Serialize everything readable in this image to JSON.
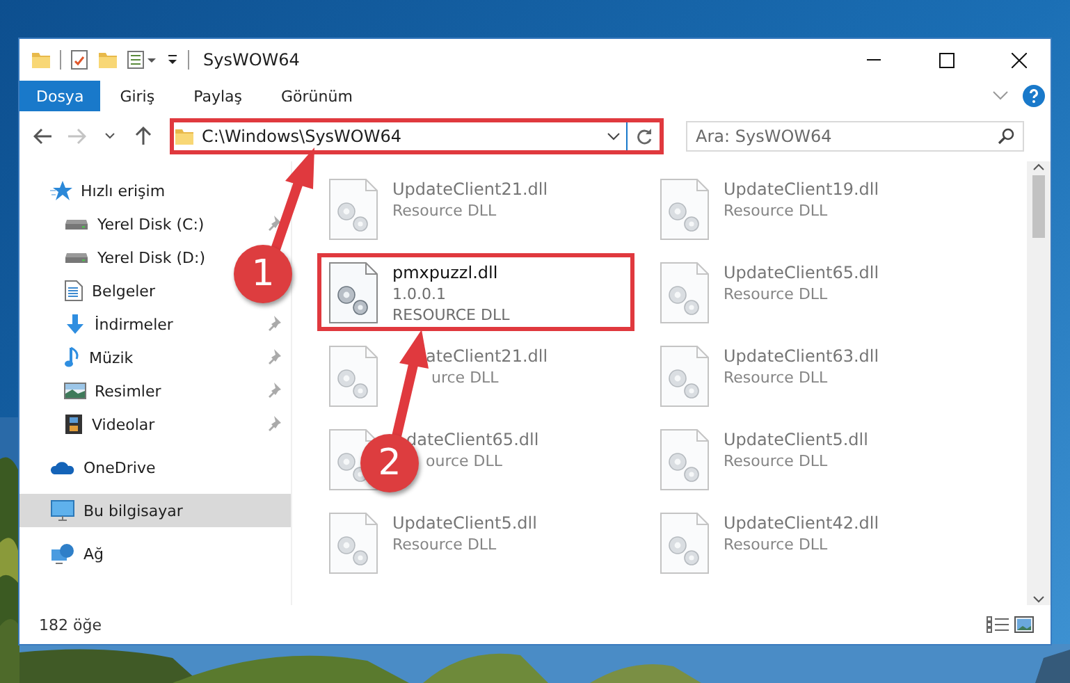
{
  "window": {
    "title": "SysWOW64"
  },
  "ribbon_tabs": [
    {
      "label": "Dosya",
      "selected": true
    },
    {
      "label": "Giriş",
      "selected": false
    },
    {
      "label": "Paylaş",
      "selected": false
    },
    {
      "label": "Görünüm",
      "selected": false
    }
  ],
  "address": {
    "path": "C:\\Windows\\SysWOW64",
    "highlighted": true
  },
  "search": {
    "placeholder": "Ara: SysWOW64"
  },
  "sidebar": {
    "items": [
      {
        "label": "Hızlı erişim",
        "kind": "star",
        "selected": false,
        "children": [
          {
            "label": "Yerel Disk (C:)",
            "kind": "drive",
            "pinned": true
          },
          {
            "label": "Yerel Disk (D:)",
            "kind": "drive",
            "pinned": false
          },
          {
            "label": "Belgeler",
            "kind": "docs",
            "pinned": false
          },
          {
            "label": "İndirmeler",
            "kind": "download",
            "pinned": true
          },
          {
            "label": "Müzik",
            "kind": "music",
            "pinned": true
          },
          {
            "label": "Resimler",
            "kind": "pictures",
            "pinned": true
          },
          {
            "label": "Videolar",
            "kind": "videos",
            "pinned": true
          }
        ]
      },
      {
        "label": "OneDrive",
        "kind": "cloud",
        "selected": false
      },
      {
        "label": "Bu bilgisayar",
        "kind": "pc",
        "selected": true
      },
      {
        "label": "Ağ",
        "kind": "network",
        "selected": false
      }
    ]
  },
  "files": [
    {
      "kind": "file",
      "name": "UpdateClient21.dll",
      "details": [
        "Resource DLL"
      ],
      "blurred": true,
      "highlighted": false
    },
    {
      "kind": "file",
      "name": "UpdateClient19.dll",
      "details": [
        "Resource DLL"
      ],
      "blurred": true,
      "highlighted": false
    },
    {
      "kind": "file",
      "name": "pmxpuzzl.dll",
      "details": [
        "1.0.0.1",
        "RESOURCE DLL"
      ],
      "blurred": false,
      "highlighted": true
    },
    {
      "kind": "file",
      "name": "UpdateClient65.dll",
      "details": [
        "Resource DLL"
      ],
      "blurred": true,
      "highlighted": false
    },
    {
      "kind": "under_arrow",
      "name": "ateClient21.dll",
      "details": [
        "urce DLL"
      ],
      "blurred": true,
      "highlighted": false
    },
    {
      "kind": "file",
      "name": "UpdateClient63.dll",
      "details": [
        "Resource DLL"
      ],
      "blurred": true,
      "highlighted": false
    },
    {
      "kind": "under_marker",
      "name": "dateClient65.dll",
      "details": [
        "ource DLL"
      ],
      "blurred": true,
      "highlighted": false
    },
    {
      "kind": "file",
      "name": "UpdateClient5.dll",
      "details": [
        "Resource DLL"
      ],
      "blurred": true,
      "highlighted": false
    },
    {
      "kind": "file",
      "name": "UpdateClient5.dll",
      "details": [
        "Resource DLL"
      ],
      "blurred": true,
      "highlighted": false
    },
    {
      "kind": "file",
      "name": "UpdateClient42.dll",
      "details": [
        "Resource DLL"
      ],
      "blurred": true,
      "highlighted": false
    }
  ],
  "status_bar": {
    "count": "182 öğe"
  },
  "annotations": [
    {
      "label": "1"
    },
    {
      "label": "2"
    }
  ]
}
